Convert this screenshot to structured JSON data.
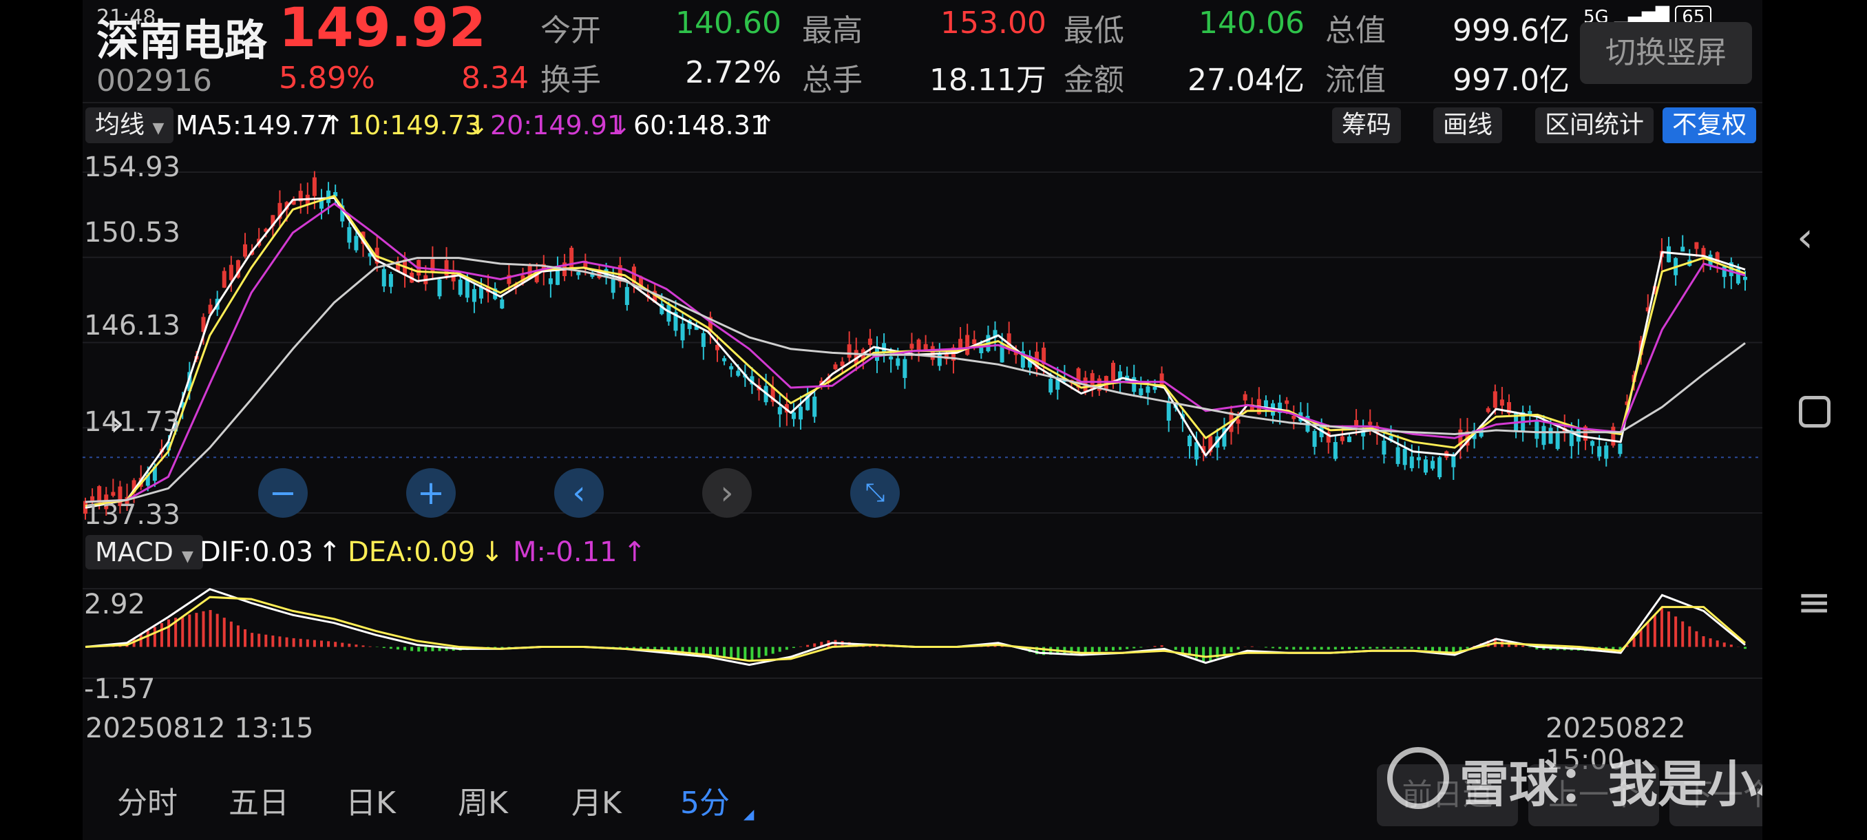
{
  "status": {
    "time": "21:48",
    "network": "5G",
    "battery": "65"
  },
  "header": {
    "name": "深南电路",
    "price": "149.92",
    "code": "002916",
    "change_pct": "5.89%",
    "change_abs": "8.34",
    "stats_row1": [
      {
        "label": "今开",
        "value": "140.60",
        "color": "green"
      },
      {
        "label": "最高",
        "value": "153.00",
        "color": "red"
      },
      {
        "label": "最低",
        "value": "140.06",
        "color": "green"
      },
      {
        "label": "总值",
        "value": "999.6亿",
        "color": "white"
      }
    ],
    "stats_row2": [
      {
        "label": "换手",
        "value": "2.72%",
        "color": "white"
      },
      {
        "label": "总手",
        "value": "18.11万",
        "color": "white"
      },
      {
        "label": "金额",
        "value": "27.04亿",
        "color": "white"
      },
      {
        "label": "流值",
        "value": "997.0亿",
        "color": "white"
      }
    ],
    "switch_button": "切换竖屏"
  },
  "ma_bar": {
    "selector": "均线",
    "ma5": "MA5:149.77",
    "ma10": "10:149.73",
    "ma20": "20:149.91",
    "ma60": "60:148.31",
    "buttons": [
      "筹码",
      "画线",
      "区间统计",
      "不复权"
    ]
  },
  "price_axis": {
    "labels": [
      "154.93",
      "150.53",
      "146.13",
      "141.73",
      "137.33"
    ]
  },
  "macd_bar": {
    "selector": "MACD",
    "dif": "DIF:0.03",
    "dea": "DEA:0.09",
    "m": "M:-0.11"
  },
  "macd_axis": {
    "labels": [
      "2.92",
      "-1.57"
    ]
  },
  "time_axis": {
    "start": "20250812 13:15",
    "end": "20250822 15:00"
  },
  "period_tabs": [
    "分时",
    "五日",
    "日K",
    "周K",
    "月K",
    "5分"
  ],
  "active_tab": "5分",
  "overlay_buttons": [
    "前日道",
    "上一个",
    "下一个"
  ],
  "watermark": "雪球：我是小小缠",
  "colors": {
    "up": "#e53935",
    "down": "#29c4d6",
    "ma5": "#ffffff",
    "ma10": "#ffee55",
    "ma20": "#d23ad2",
    "ma60": "#cfcfcf"
  },
  "chart_data": {
    "type": "line",
    "title": "",
    "ylim": [
      137.33,
      154.93
    ],
    "series": [
      {
        "name": "MA5",
        "values": [
          137.6,
          138.0,
          141.0,
          147.5,
          150.8,
          153.5,
          153.6,
          150.4,
          149.3,
          149.6,
          148.5,
          149.8,
          150.0,
          149.4,
          147.8,
          146.7,
          144.2,
          142.5,
          144.5,
          145.9,
          145.5,
          145.6,
          146.5,
          144.8,
          143.5,
          144.3,
          143.8,
          140.3,
          142.9,
          142.6,
          141.3,
          141.6,
          140.5,
          140.3,
          142.7,
          142.3,
          141.3,
          141.0,
          150.8,
          150.6,
          149.9
        ]
      },
      {
        "name": "MA10",
        "values": [
          137.7,
          138.0,
          140.5,
          146.5,
          150.0,
          153.0,
          153.7,
          150.6,
          149.8,
          149.7,
          148.7,
          149.9,
          150.0,
          149.6,
          148.2,
          146.9,
          144.9,
          143.0,
          144.2,
          145.6,
          145.7,
          145.7,
          146.2,
          145.0,
          143.8,
          144.1,
          143.9,
          141.2,
          142.6,
          142.6,
          141.6,
          141.7,
          141.0,
          140.7,
          142.3,
          142.4,
          141.7,
          141.4,
          149.8,
          150.5,
          149.7
        ]
      },
      {
        "name": "MA20",
        "values": [
          137.9,
          138.0,
          139.2,
          144.0,
          148.7,
          151.8,
          153.3,
          151.7,
          150.0,
          149.8,
          149.4,
          149.9,
          150.3,
          149.9,
          148.9,
          147.3,
          145.8,
          143.8,
          143.9,
          145.4,
          145.7,
          145.8,
          146.0,
          145.2,
          144.1,
          144.1,
          144.1,
          142.6,
          142.9,
          142.5,
          141.8,
          141.8,
          141.4,
          141.2,
          141.9,
          142.1,
          141.7,
          141.5,
          146.8,
          150.2,
          149.6
        ]
      },
      {
        "name": "MA60",
        "values": [
          137.9,
          138.0,
          138.6,
          140.7,
          143.2,
          145.8,
          148.2,
          150.0,
          150.5,
          150.5,
          150.2,
          150.1,
          149.8,
          149.3,
          148.4,
          147.4,
          146.4,
          145.8,
          145.6,
          145.5,
          145.5,
          145.3,
          145.0,
          144.5,
          144.0,
          143.5,
          143.1,
          142.7,
          142.3,
          142.0,
          141.8,
          141.6,
          141.5,
          141.4,
          141.6,
          141.5,
          141.5,
          141.5,
          142.8,
          144.5,
          146.1
        ]
      }
    ],
    "macd": {
      "ylim": [
        -1.57,
        2.92
      ],
      "dif": [
        0.0,
        0.2,
        1.5,
        2.9,
        2.2,
        1.6,
        1.2,
        0.6,
        0.1,
        -0.1,
        -0.1,
        0.0,
        0.0,
        -0.1,
        -0.3,
        -0.5,
        -0.9,
        -0.5,
        0.2,
        0.1,
        0.0,
        0.0,
        0.2,
        -0.3,
        -0.4,
        -0.3,
        -0.1,
        -0.8,
        -0.2,
        -0.3,
        -0.3,
        -0.2,
        -0.2,
        -0.4,
        0.4,
        0.0,
        -0.1,
        -0.3,
        2.6,
        1.8,
        0.1
      ],
      "dea": [
        0.0,
        0.1,
        1.0,
        2.5,
        2.4,
        1.8,
        1.4,
        0.8,
        0.3,
        0.0,
        -0.1,
        0.0,
        0.0,
        -0.1,
        -0.2,
        -0.4,
        -0.7,
        -0.6,
        0.0,
        0.1,
        0.0,
        0.0,
        0.1,
        -0.1,
        -0.3,
        -0.3,
        -0.2,
        -0.5,
        -0.3,
        -0.3,
        -0.3,
        -0.2,
        -0.2,
        -0.3,
        0.2,
        0.1,
        0.0,
        -0.2,
        2.0,
        2.0,
        0.2
      ]
    }
  }
}
